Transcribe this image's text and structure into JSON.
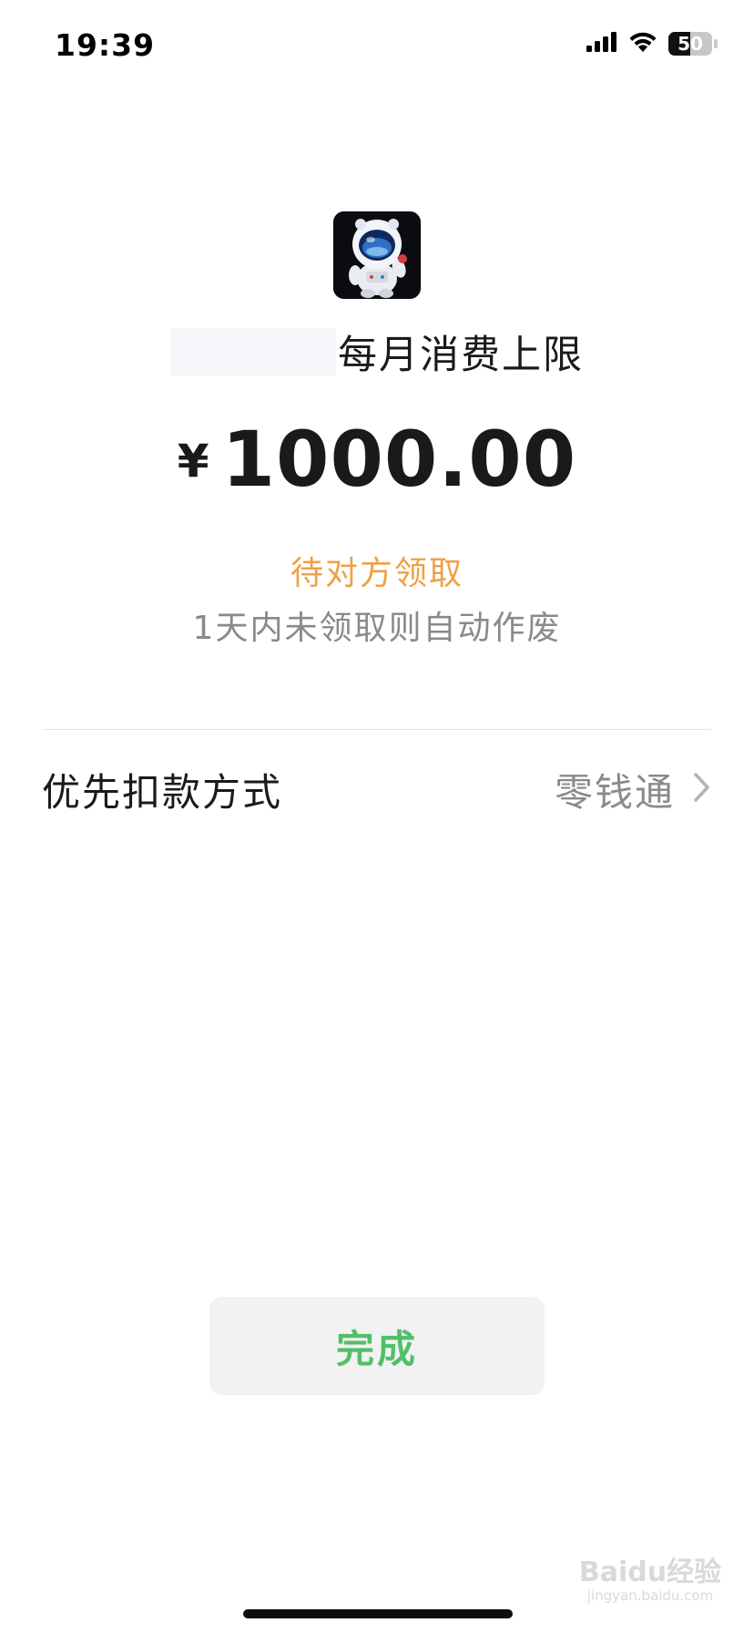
{
  "status_bar": {
    "time": "19:39",
    "battery_level": "50",
    "battery_fraction": 0.5,
    "icons": [
      "cellular-signal-icon",
      "wifi-icon",
      "battery-icon"
    ]
  },
  "header": {
    "avatar_icon": "astronaut-avatar",
    "title": "每月消费上限"
  },
  "amount": {
    "currency": "¥",
    "value": "1000.00"
  },
  "status": {
    "pending": "待对方领取",
    "pending_color": "#f0a046",
    "expire_note": "1天内未领取则自动作废"
  },
  "payment": {
    "label": "优先扣款方式",
    "value": "零钱通",
    "chevron_icon": "chevron-right-icon"
  },
  "actions": {
    "done_label": "完成",
    "done_color": "#4fc06a"
  },
  "watermark": {
    "brand": "Baidu经验",
    "url": "jingyan.baidu.com"
  }
}
